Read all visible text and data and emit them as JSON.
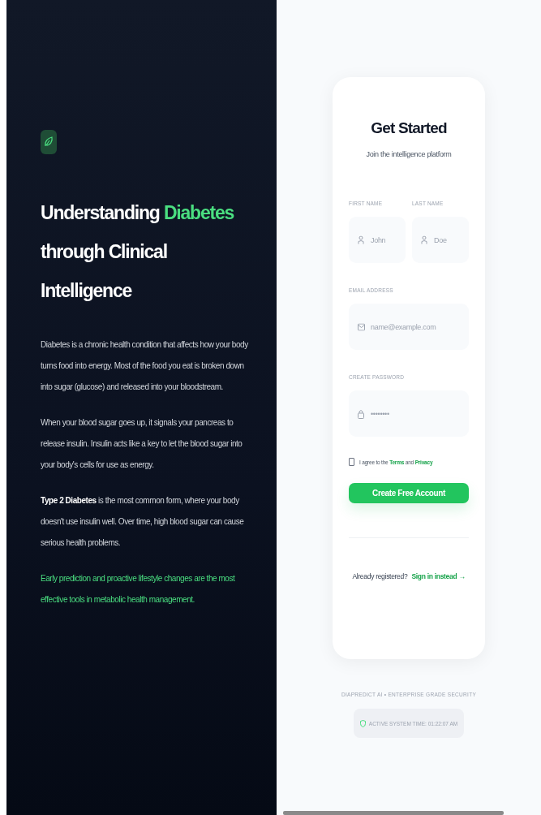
{
  "hero": {
    "title_start": "Understanding",
    "title_accent": "Diabetes",
    "title_end": "through Clinical Intelligence",
    "paragraphs": [
      {
        "kind": "plain",
        "text": "Diabetes is a chronic health condition that affects how your body turns food into energy. Most of the food you eat is broken down into sugar (glucose) and released into your bloodstream."
      },
      {
        "kind": "plain",
        "text": "When your blood sugar goes up, it signals your pancreas to release insulin. Insulin acts like a key to let the blood sugar into your body's cells for use as energy."
      },
      {
        "kind": "plain",
        "text": "**Type 2 Diabetes** is the most common form, where your body doesn't use insulin well. Over time, high blood sugar can cause serious health problems."
      },
      {
        "kind": "accent",
        "text": "Early prediction and proactive lifestyle changes are the most effective tools in metabolic health management."
      }
    ]
  },
  "form": {
    "title": "Get Started",
    "subtitle": "Join the intelligence platform",
    "first_name": {
      "label": "FIRST NAME",
      "placeholder": "John"
    },
    "last_name": {
      "label": "LAST NAME",
      "placeholder": "Doe"
    },
    "email": {
      "label": "EMAIL ADDRESS",
      "placeholder": "name@example.com"
    },
    "password": {
      "label": "CREATE PASSWORD",
      "placeholder": "••••••••"
    },
    "agree": {
      "checked": false,
      "before": "I agree to the",
      "terms": "Terms",
      "and": "and",
      "privacy": "Privacy"
    },
    "submit": "Create Free Account",
    "signin": {
      "question": "Already registered?",
      "link": "Sign in instead →"
    }
  },
  "footer": {
    "brand": "DIAPREDICT AI • ENTERPRISE GRADE SECURITY",
    "status": "ACTIVE SYSTEM TIME: 01:22:07 AM"
  }
}
